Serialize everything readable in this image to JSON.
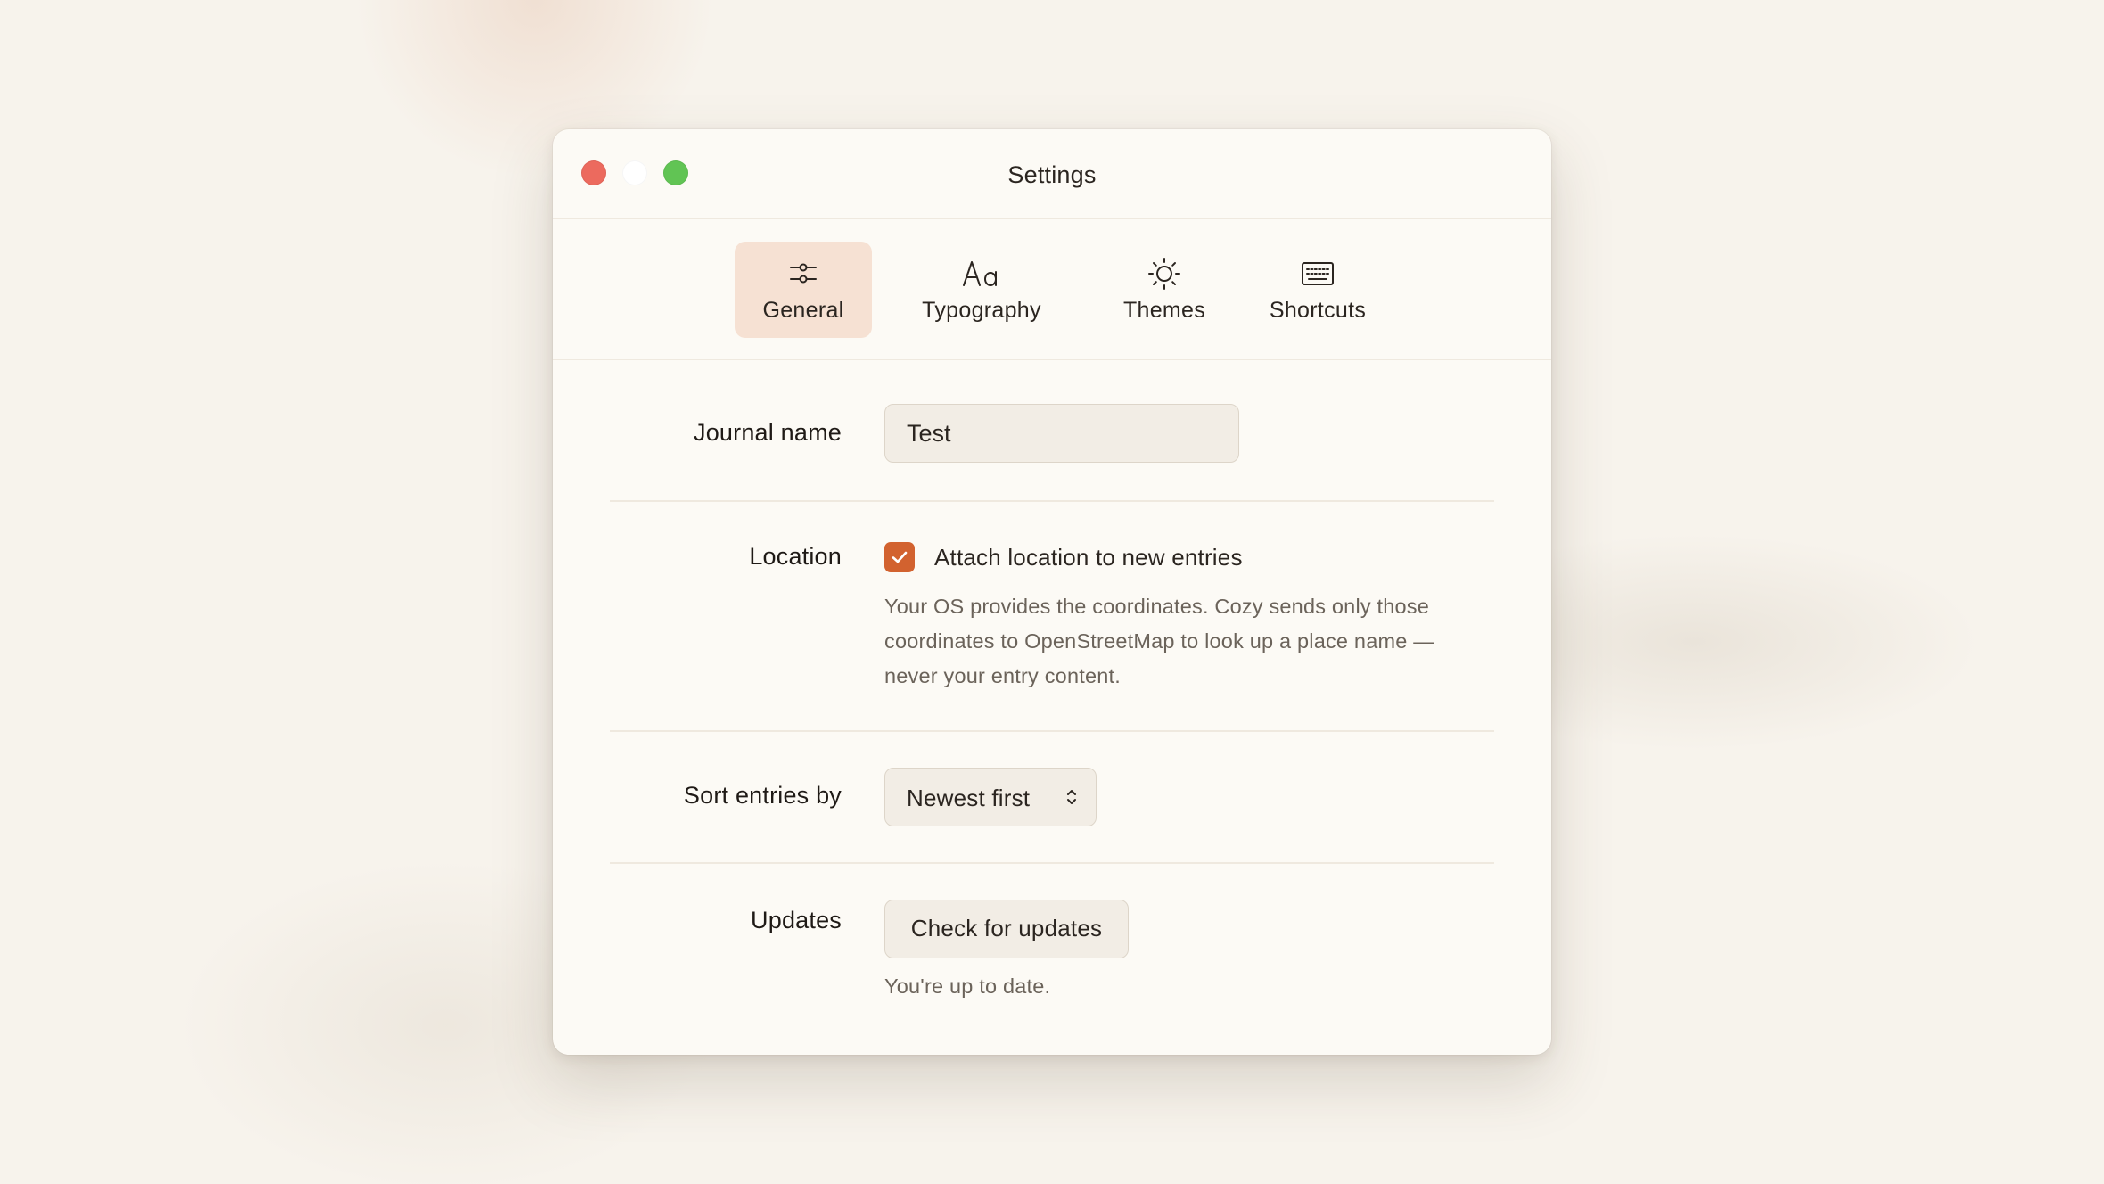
{
  "window": {
    "title": "Settings",
    "traffic_lights": {
      "close_color": "#ec6a5e",
      "minimize_color": "#ffffff",
      "maximize_color": "#61c454"
    }
  },
  "tabs": [
    {
      "label": "General",
      "icon": "sliders-icon",
      "active": true
    },
    {
      "label": "Typography",
      "icon": "typography-icon",
      "active": false
    },
    {
      "label": "Themes",
      "icon": "sun-icon",
      "active": false
    },
    {
      "label": "Shortcuts",
      "icon": "keyboard-icon",
      "active": false
    }
  ],
  "general": {
    "journal_name": {
      "label": "Journal name",
      "value": "Test"
    },
    "location": {
      "label": "Location",
      "checkbox_label": "Attach location to new entries",
      "checked": true,
      "help": "Your OS provides the coordinates. Cozy sends only those coordinates to OpenStreetMap to look up a place name — never your entry content."
    },
    "sort": {
      "label": "Sort entries by",
      "value": "Newest first"
    },
    "updates": {
      "label": "Updates",
      "button_label": "Check for updates",
      "status": "You're up to date."
    }
  },
  "colors": {
    "accent": "#d2622f",
    "active_tab_bg": "#f6e1d3",
    "window_bg": "#fcfaf5"
  }
}
